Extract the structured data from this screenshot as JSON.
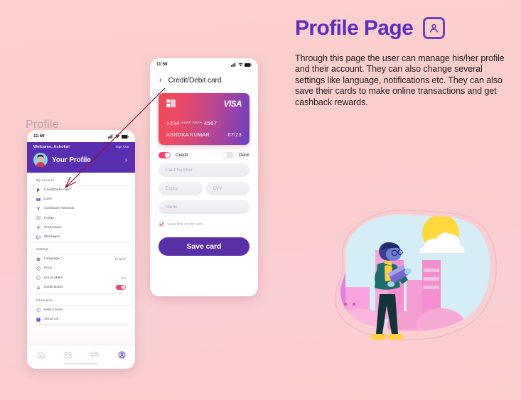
{
  "theme": {
    "background": "#fbcecd",
    "accent_purple": "#5b2ec0",
    "accent_pink": "#f0386c",
    "card_gradient_from": "#f04a55",
    "card_gradient_to": "#6d3fc0"
  },
  "right_panel": {
    "title": "Profile Page",
    "title_icon": "user-square-icon",
    "description": "Through this page the user  can manage his/her profile and their account. They can also change several settings like language, notifications etc. They can also save their cards to make online transactions and get cashback rewards."
  },
  "left_phone": {
    "watermark_label": "Profile",
    "status_bar": {
      "time": "11:59",
      "icons": [
        "signal-icon",
        "wifi-icon",
        "battery-icon"
      ]
    },
    "header": {
      "welcome": "Welcome, Ashoka!",
      "sign_out": "Sign Out",
      "profile_title": "Your Profile",
      "chevron": "›",
      "avatar": "user-avatar"
    },
    "sections": [
      {
        "title": "My Account",
        "items": [
          {
            "label": "Credit/Debit card",
            "icon": "card-icon",
            "value": ""
          },
          {
            "label": "Cash",
            "icon": "cash-icon",
            "value": ""
          },
          {
            "label": "Cashback Rewards",
            "icon": "rewards-icon",
            "value": ""
          },
          {
            "label": "Points",
            "icon": "points-icon",
            "value": ""
          },
          {
            "label": "Promotions",
            "icon": "promotions-icon",
            "value": ""
          },
          {
            "label": "Messages",
            "icon": "messages-icon",
            "value": ""
          }
        ]
      },
      {
        "title": "Settings",
        "items": [
          {
            "label": "Language",
            "icon": "language-icon",
            "value": "English"
          },
          {
            "label": "Price",
            "icon": "price-icon",
            "value": ""
          },
          {
            "label": "Km or Miles",
            "icon": "distance-icon",
            "value": "Km"
          },
          {
            "label": "Notifications",
            "icon": "notifications-icon",
            "value": "",
            "toggle": "on"
          }
        ]
      },
      {
        "title": "Information",
        "items": [
          {
            "label": "Help Centre",
            "icon": "help-icon",
            "value": ""
          },
          {
            "label": "About Us",
            "icon": "about-icon",
            "value": ""
          }
        ]
      }
    ],
    "bottom_nav": [
      {
        "name": "home-icon",
        "active": false
      },
      {
        "name": "calendar-icon",
        "active": false
      },
      {
        "name": "chat-icon",
        "active": false
      },
      {
        "name": "profile-icon",
        "active": true
      }
    ]
  },
  "right_phone": {
    "status_bar": {
      "time": "11:59",
      "icons": [
        "signal-icon",
        "wifi-icon",
        "battery-icon"
      ]
    },
    "nav": {
      "back": "‹",
      "title": "Credit/Debit card"
    },
    "card": {
      "brand": "VISA",
      "number": "1234 **** **** 4567",
      "holder": "ASHOKA KUMAR",
      "expiry": "07/23",
      "chip_icon": "chip-icon"
    },
    "payment_type": {
      "credit_label": "Credit",
      "credit_state": "on",
      "debit_label": "Debit",
      "debit_state": "off"
    },
    "form": {
      "card_number_placeholder": "Card Number",
      "expiry_placeholder": "Expiry",
      "cvv_placeholder": "CVV",
      "name_placeholder": "Name",
      "save_checkbox_label": "Save this credit card",
      "save_checkbox_checked": true,
      "submit_label": "Save card"
    }
  },
  "illustration": {
    "name": "person-reading-book-city-illustration",
    "elements": [
      "sun",
      "clouds",
      "city-buildings",
      "person-with-book"
    ]
  },
  "annotation": {
    "arrow": "pointer-arrow-from-card-screen-to-menu-item",
    "color": "#8c1730"
  }
}
